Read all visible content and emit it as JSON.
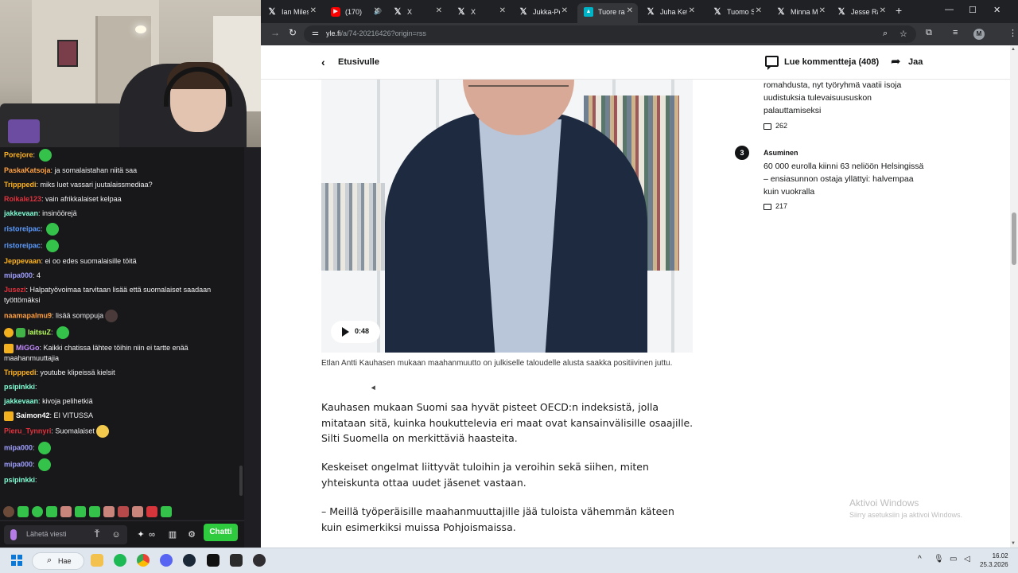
{
  "browser": {
    "tabs": [
      {
        "icon": "x-icon",
        "title": "Ian Miles",
        "active": false
      },
      {
        "icon": "youtube-icon",
        "title": "(170)",
        "active": false
      },
      {
        "icon": "x-icon",
        "title": "X",
        "active": false
      },
      {
        "icon": "x-icon",
        "title": "X",
        "active": false
      },
      {
        "icon": "x-icon",
        "title": "Jukka-Pe",
        "active": false
      },
      {
        "icon": "yle-icon",
        "title": "Tuore ra",
        "active": true
      },
      {
        "icon": "x-icon",
        "title": "Juha Ket",
        "active": false
      },
      {
        "icon": "x-icon",
        "title": "Tuomo S",
        "active": false
      },
      {
        "icon": "x-icon",
        "title": "Minna M",
        "active": false
      },
      {
        "icon": "x-icon",
        "title": "Jesse Ra",
        "active": false
      }
    ],
    "url_host": "yle.fi",
    "url_path": "/a/74-20216426?origin=rss",
    "profile_initial": "M"
  },
  "page": {
    "back_label": "Etusivulle",
    "comments_label": "Lue kommentteja (408)",
    "share_label": "Jaa",
    "video_time": "0:48",
    "caption": "Etlan Antti Kauhasen mukaan maahanmuutto on julkiselle taloudelle alusta saakka positiivinen juttu.",
    "paragraphs": [
      "Kauhasen mukaan Suomi saa hyvät pisteet OECD:n indeksistä, jolla mitataan sitä, kuinka houkuttelevia eri maat ovat kansainvälisille osaajille. Silti Suomella on merkittäviä haasteita.",
      "Keskeiset ongelmat liittyvät tuloihin ja veroihin sekä siihen, miten yhteiskunta ottaa uudet jäsenet vastaan.",
      "– Meillä työperäisille maahanmuuttajille jää tuloista vähemmän käteen kuin esimerkiksi muissa Pohjoismaissa."
    ],
    "sidebar": {
      "prev_item_tail": "romahdusta, nyt työryhmä vaatii isoja uudistuksia tulevaisuususkon palauttamiseksi",
      "prev_item_comments": "262",
      "item_number": "3",
      "item_category": "Asuminen",
      "item_title": "60 000 eurolla kiinni 63 neliöön Helsingissä – ensiasunnon ostaja yllättyi: halvempaa kuin vuokralla",
      "item_comments": "217"
    },
    "activate_title": "Aktivoi Windows",
    "activate_sub": "Siirry asetuksiin ja aktivoi Windows."
  },
  "chat": {
    "messages": [
      {
        "user": "Porejore",
        "color": "#ffb31a",
        "text": "",
        "emotes": [
          "green"
        ]
      },
      {
        "user": "PaskaKatsoja",
        "color": "#ff9f3f",
        "text": "ja somalaistahan niitä saa",
        "emotes": []
      },
      {
        "user": "Tripppedi",
        "color": "#ffb31a",
        "text": "miks luet vassari juutalaissmediaa?",
        "emotes": []
      },
      {
        "user": "Roikale123",
        "color": "#e0323c",
        "text": "vain afrikkalaiset kelpaa",
        "emotes": []
      },
      {
        "user": "jakkevaan",
        "color": "#7fffd4",
        "text": "insinöörejä",
        "emotes": []
      },
      {
        "user": "ristoreipac",
        "color": "#5b9cff",
        "text": "",
        "emotes": [
          "green"
        ]
      },
      {
        "user": "ristoreipac",
        "color": "#5b9cff",
        "text": "",
        "emotes": [
          "green"
        ]
      },
      {
        "user": "Jeppevaan",
        "color": "#ffb31a",
        "text": "ei oo edes suomalaisille töitä",
        "emotes": []
      },
      {
        "user": "mipa000",
        "color": "#9e9eff",
        "text": "4",
        "emotes": []
      },
      {
        "user": "Jusezi",
        "color": "#e0323c",
        "text": "Halpatyövoimaa tarvitaan lisää että suomalaiset saadaan työttömäksi",
        "emotes": []
      },
      {
        "user": "naamapalmu9",
        "color": "#ff9f3f",
        "text": "lisää somppuja",
        "emotes": [
          "dark"
        ]
      },
      {
        "user": "laitsuZ",
        "color": "#b8ff5c",
        "text": "",
        "emotes": [
          "green"
        ],
        "badges": [
          "round",
          "green"
        ]
      },
      {
        "user": "MiGGo",
        "color": "#c58cff",
        "text": "Kaikki chatissa lähtee töihin niin ei tartte enää maahanmuuttajia",
        "emotes": [],
        "badges": [
          "crown"
        ]
      },
      {
        "user": "Tripppedi",
        "color": "#ffb31a",
        "text": "youtube klipeissä kielsit",
        "emotes": []
      },
      {
        "user": "psipinkki",
        "color": "#7fffd4",
        "text": "",
        "emotes": [
          "face"
        ]
      },
      {
        "user": "jakkevaan",
        "color": "#7fffd4",
        "text": "kivoja pelihetkiä",
        "emotes": []
      },
      {
        "user": "Saimon42",
        "color": "#ffffff",
        "text": "EI VITUSSA",
        "emotes": [],
        "badges": [
          "crown"
        ]
      },
      {
        "user": "Pieru_Tynnyri",
        "color": "#e0323c",
        "text": "Suomalaiset",
        "emotes": [
          "yellow"
        ]
      },
      {
        "user": "mipa000",
        "color": "#9e9eff",
        "text": "",
        "emotes": [
          "green"
        ]
      },
      {
        "user": "mipa000",
        "color": "#9e9eff",
        "text": "",
        "emotes": [
          "green"
        ]
      },
      {
        "user": "psipinkki",
        "color": "#7fffd4",
        "text": "",
        "emotes": [
          "face",
          "face",
          "face",
          "face"
        ]
      }
    ],
    "input_placeholder": "Lähetä viesti",
    "send_label": "Chatti"
  },
  "taskbar": {
    "search_label": "Hae",
    "time": "16.02",
    "date": "25.3.2026"
  },
  "colors": {
    "chat_bg": "#18181b",
    "send_button": "#2fcb3f",
    "taskbar": "#dfe6ee"
  }
}
